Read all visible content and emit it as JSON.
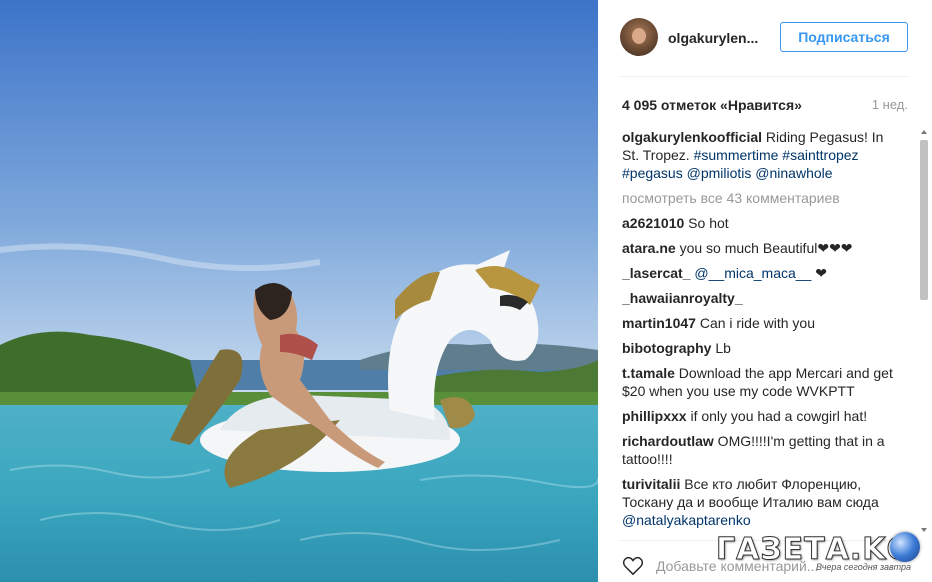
{
  "post": {
    "username": "olgakurylen...",
    "follow_label": "Подписаться",
    "likes": "4 095 отметок «Нравится»",
    "time": "1 нед.",
    "caption": {
      "user": "olgakurylenkoofficial",
      "text": " Riding Pegasus! In St. Tropez. ",
      "tags": [
        "#summertime",
        "#sainttropez",
        "#pegasus",
        "@pmiliotis",
        "@ninawhole"
      ]
    },
    "view_all": "посмотреть все 43 комментариев",
    "comments": [
      {
        "user": "a2621010",
        "text": " So hot ",
        "tag": ""
      },
      {
        "user": "atara.ne",
        "text": " you so much Beautiful❤❤❤",
        "tag": ""
      },
      {
        "user": "_lasercat_",
        "text": " ❤",
        "tag": " @__mica_maca__"
      },
      {
        "user": "_hawaiianroyalty_",
        "text": " ",
        "tag": ""
      },
      {
        "user": "martin1047",
        "text": " Can i ride with you",
        "tag": ""
      },
      {
        "user": "bibotography",
        "text": " Lb",
        "tag": ""
      },
      {
        "user": "t.tamale",
        "text": " Download the app Mercari and get $20 when you use my code WVKPTT",
        "tag": ""
      },
      {
        "user": "phillipxxx",
        "text": " if only you had a cowgirl hat!",
        "tag": ""
      },
      {
        "user": "richardoutlaw",
        "text": " OMG!!!!I'm getting that in a tattoo!!!!",
        "tag": ""
      },
      {
        "user": "turivitalii",
        "text": " Все кто любит Флоренцию, Тоскану да и вообще Италию вам сюда ",
        "tag": "@natalyakaptarenko"
      }
    ],
    "comment_placeholder": "Добавьте комментарий..."
  },
  "watermark": {
    "logo": "ГАЗЕТА.KG",
    "tagline": "Вчера сегодня завтра"
  },
  "icons": [
    "heart-icon",
    "scroll-up-icon",
    "scroll-down-icon",
    "globe-icon"
  ],
  "colors": {
    "accent": "#3897f0",
    "tag": "#003569",
    "muted": "#999999"
  }
}
